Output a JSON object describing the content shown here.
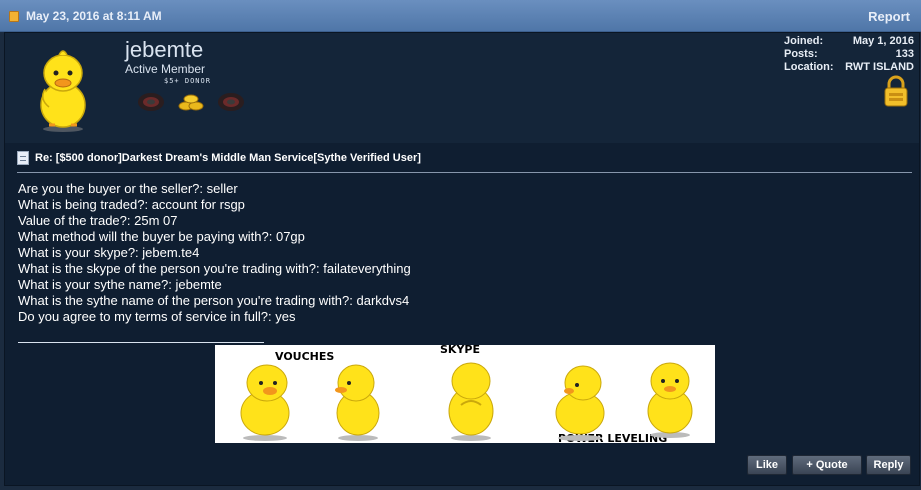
{
  "header": {
    "date": "May 23, 2016 at 8:11 AM",
    "report_label": "Report",
    "doc_icon": "document-icon"
  },
  "user": {
    "name": "jebemte",
    "title": "Active Member",
    "donor_label": "$5+ DONOR",
    "avatar": "duck-avatar",
    "badges": [
      "dark-badge",
      "gold-coins-badge",
      "dark-badge"
    ],
    "stats": [
      {
        "label": "Joined:",
        "value": "May 1, 2016"
      },
      {
        "label": "Posts:",
        "value": "133"
      },
      {
        "label": "Location:",
        "value": "RWT ISLAND"
      }
    ],
    "lock_icon": "lock-icon"
  },
  "post": {
    "title": "Re: [$500 donor]Darkest Dream's Middle Man Service[Sythe Verified User]",
    "lines": [
      "Are you the buyer or the seller?: seller",
      "What is being traded?: account for rsgp",
      "Value of the trade?: 25m 07",
      "What method will the buyer be paying with?: 07gp",
      "What is your skype?: jebem.te4",
      "What is the skype of the person you're trading with?: failateverything",
      "What is your sythe name?: jebemte",
      "What is the sythe name of the person you're trading with?: darkdvs4",
      "Do you agree to my terms of service in full?: yes"
    ]
  },
  "signature": {
    "labels": {
      "vouches": "VOUCHES",
      "skype": "SKYPE",
      "power_leveling": "POWER LEVELING"
    }
  },
  "actions": {
    "like": "Like",
    "quote": "+ Quote",
    "reply": "Reply"
  },
  "colors": {
    "header_bar": "#5a80b2",
    "panel_bg": "#0f1e31",
    "duck_yellow": "#ffe21a"
  }
}
